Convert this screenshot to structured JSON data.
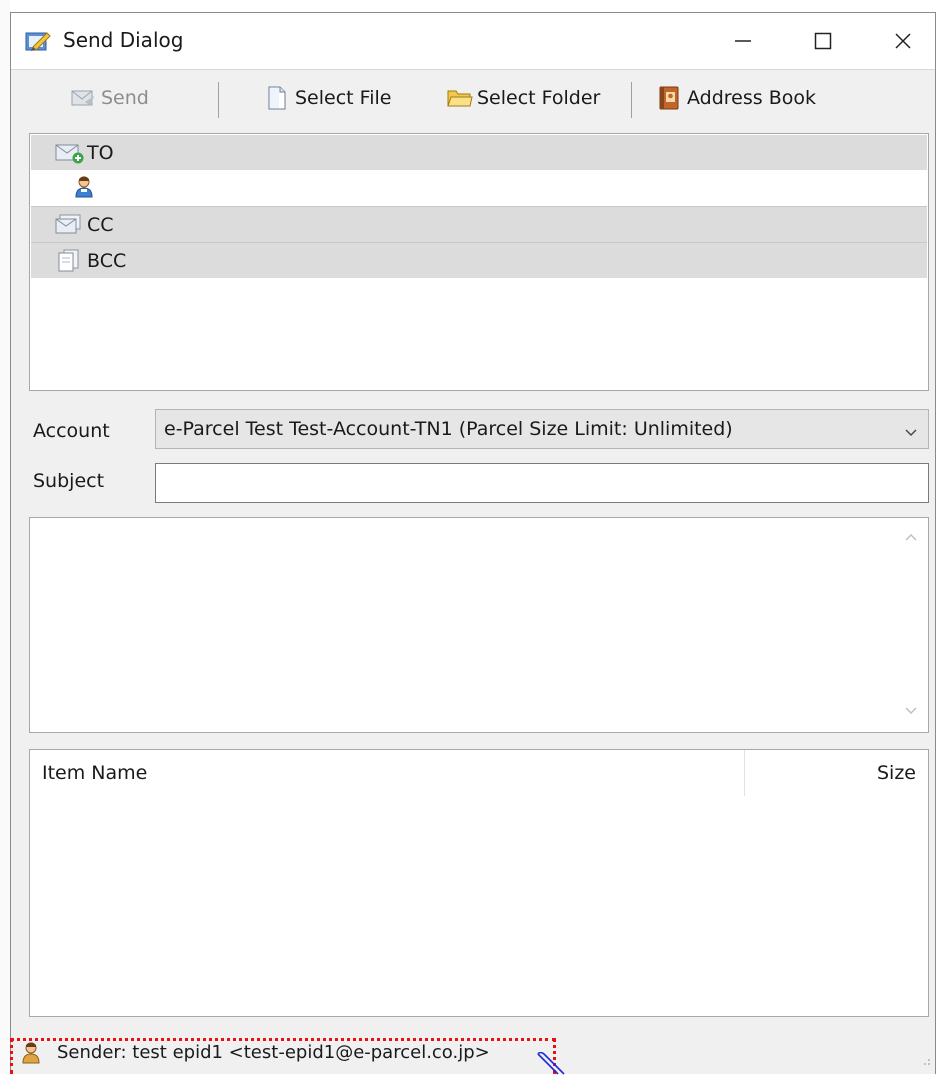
{
  "window": {
    "title": "Send Dialog",
    "icons": {
      "app": "send-dialog-icon",
      "minimize": "minimize-icon",
      "maximize": "maximize-icon",
      "close": "close-icon"
    }
  },
  "toolbar": {
    "send_label": "Send",
    "select_file_label": "Select File",
    "select_folder_label": "Select Folder",
    "address_book_label": "Address Book"
  },
  "recipients": {
    "to_label": "TO",
    "cc_label": "CC",
    "bcc_label": "BCC"
  },
  "form": {
    "account_label": "Account",
    "account_value": "e-Parcel Test Test-Account-TN1 (Parcel Size Limit: Unlimited)",
    "subject_label": "Subject",
    "subject_value": ""
  },
  "items": {
    "columns": [
      "Item Name",
      "Size"
    ],
    "rows": []
  },
  "status": {
    "sender_text": "Sender: test epid1 <test-epid1@e-parcel.co.jp>"
  },
  "colors": {
    "annotation": "#e81010",
    "header_row": "#dcdcdc",
    "dialog_bg": "#f0f0f0"
  }
}
